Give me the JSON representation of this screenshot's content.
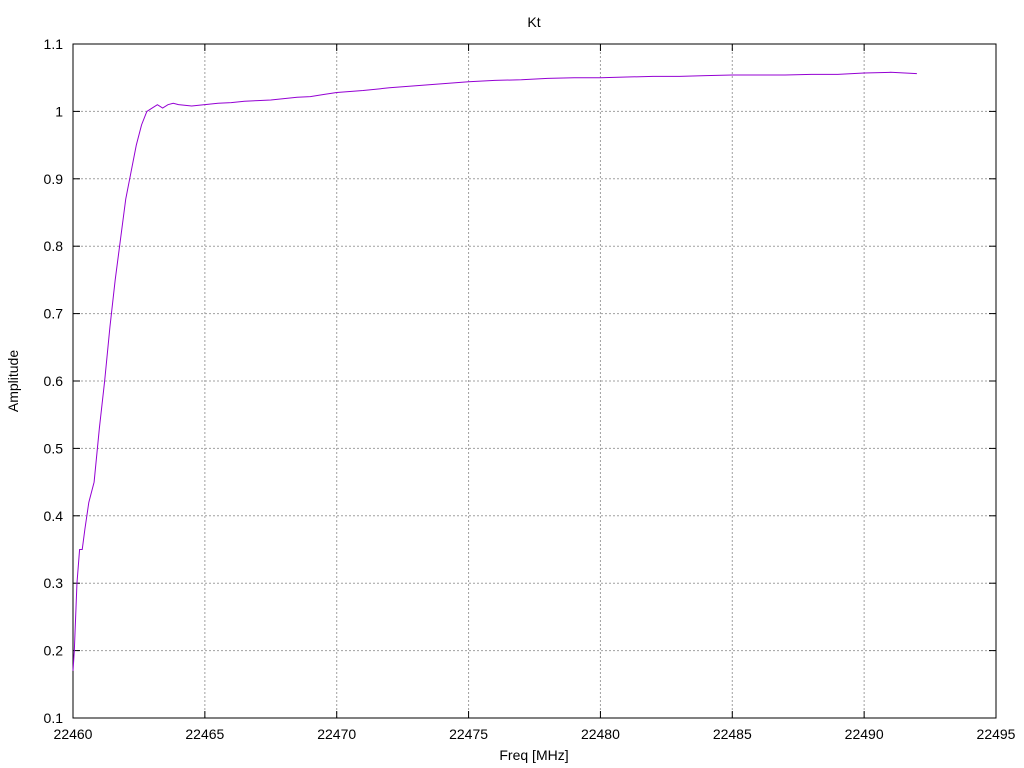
{
  "chart_data": {
    "type": "line",
    "title": "Kt",
    "xlabel": "Freq [MHz]",
    "ylabel": "Amplitude",
    "xlim": [
      22460,
      22495
    ],
    "ylim": [
      0.1,
      1.1
    ],
    "xticks": [
      22460,
      22465,
      22470,
      22475,
      22480,
      22485,
      22490,
      22495
    ],
    "yticks": [
      0.1,
      0.2,
      0.3,
      0.4,
      0.5,
      0.6,
      0.7,
      0.8,
      0.9,
      1,
      1.1
    ],
    "ytick_labels": [
      "0.1",
      "0.2",
      "0.3",
      "0.4",
      "0.5",
      "0.6",
      "0.7",
      "0.8",
      "0.9",
      "1",
      "1.1"
    ],
    "grid": true,
    "line_color": "#9400d3",
    "series": [
      {
        "values_x": [
          22460.0,
          22460.05,
          22460.15,
          22460.25,
          22460.35,
          22460.45,
          22460.6,
          22460.8,
          22461.0,
          22461.2,
          22461.4,
          22461.6,
          22461.8,
          22462.0,
          22462.2,
          22462.4,
          22462.6,
          22462.8,
          22463.0,
          22463.2,
          22463.4,
          22463.6,
          22463.8,
          22464.0,
          22464.5,
          22465.0,
          22465.5,
          22466.0,
          22466.5,
          22467.0,
          22467.5,
          22468.0,
          22468.5,
          22469.0,
          22469.5,
          22470.0,
          22471.0,
          22472.0,
          22473.0,
          22474.0,
          22475.0,
          22476.0,
          22477.0,
          22478.0,
          22479.0,
          22480.0,
          22481.0,
          22482.0,
          22483.0,
          22484.0,
          22485.0,
          22486.0,
          22487.0,
          22488.0,
          22489.0,
          22490.0,
          22491.0,
          22492.0
        ],
        "values_y": [
          0.17,
          0.2,
          0.3,
          0.35,
          0.35,
          0.38,
          0.42,
          0.45,
          0.53,
          0.6,
          0.68,
          0.75,
          0.81,
          0.87,
          0.91,
          0.95,
          0.98,
          1.0,
          1.005,
          1.01,
          1.005,
          1.01,
          1.012,
          1.01,
          1.008,
          1.01,
          1.012,
          1.013,
          1.015,
          1.016,
          1.017,
          1.019,
          1.021,
          1.022,
          1.025,
          1.028,
          1.031,
          1.035,
          1.038,
          1.041,
          1.044,
          1.046,
          1.047,
          1.049,
          1.05,
          1.05,
          1.051,
          1.052,
          1.052,
          1.053,
          1.054,
          1.054,
          1.054,
          1.055,
          1.055,
          1.057,
          1.058,
          1.056
        ]
      }
    ]
  }
}
